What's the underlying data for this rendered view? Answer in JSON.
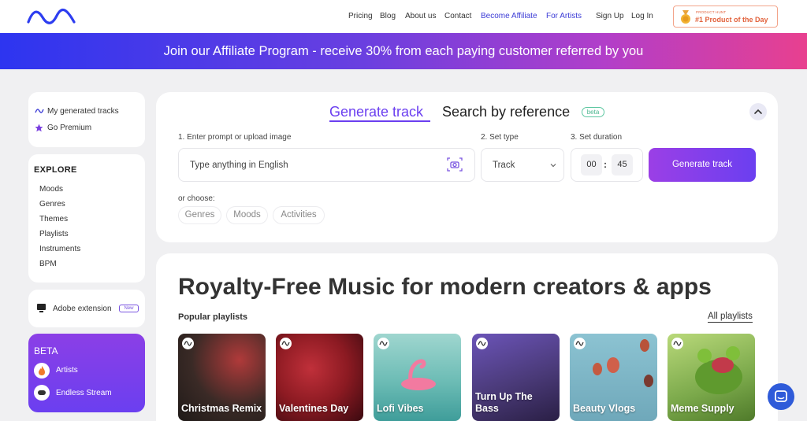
{
  "header": {
    "nav": [
      "Pricing",
      "Blog",
      "About us",
      "Contact",
      "Become Affiliate",
      "For Artists",
      "Sign Up",
      "Log In"
    ],
    "product_hunt": {
      "small": "PRODUCT HUNT",
      "big": "#1 Product of the Day"
    }
  },
  "banner": {
    "text": "Join our Affiliate Program - receive 30% from each paying customer referred by you"
  },
  "sidebar": {
    "top_items": [
      "My generated tracks",
      "Go Premium"
    ],
    "explore_title": "EXPLORE",
    "explore_items": [
      "Moods",
      "Genres",
      "Themes",
      "Playlists",
      "Instruments",
      "BPM"
    ],
    "extension": {
      "label": "Adobe extension",
      "badge": "New"
    },
    "beta": {
      "title": "BETA",
      "items": [
        "Artists",
        "Endless Stream"
      ]
    }
  },
  "generator": {
    "tab_generate": "Generate track",
    "tab_search": "Search by reference",
    "beta_pill": "beta",
    "label_prompt": "1. Enter prompt or upload image",
    "label_type": "2. Set type",
    "label_duration": "3. Set duration",
    "prompt_placeholder": "Type anything in English",
    "type_value": "Track",
    "duration_min": "00",
    "duration_sec": "45",
    "button": "Generate track",
    "or_choose": "or choose:",
    "chips": [
      "Genres",
      "Moods",
      "Activities"
    ]
  },
  "main": {
    "title": "Royalty-Free Music for modern creators & apps",
    "popular_label": "Popular playlists",
    "all_playlists": "All playlists",
    "playlists": [
      {
        "name": "Christmas Remix",
        "color": "#3a2a26"
      },
      {
        "name": "Valentines Day",
        "color": "#8c1a22"
      },
      {
        "name": "Lofi Vibes",
        "color": "#7cc5c0"
      },
      {
        "name": "Turn Up The Bass",
        "color": "#4a3a78"
      },
      {
        "name": "Beauty Vlogs",
        "color": "#7fb7c7"
      },
      {
        "name": "Meme Supply",
        "color": "#7aa84a"
      }
    ]
  },
  "colors": {
    "accent": "#6b3ff0",
    "nav_blue": "#3c3cd6",
    "ph_orange": "#e2623c"
  }
}
